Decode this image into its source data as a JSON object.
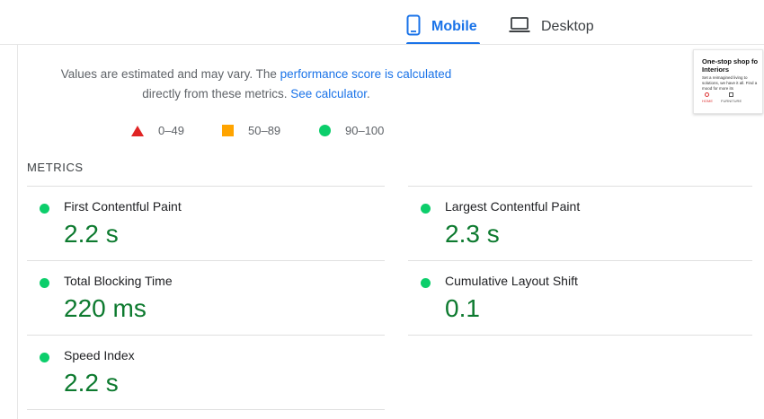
{
  "tabs": {
    "mobile": {
      "label": "Mobile",
      "icon": "smartphone-icon",
      "active": true
    },
    "desktop": {
      "label": "Desktop",
      "icon": "laptop-icon",
      "active": false
    }
  },
  "intro": {
    "text_1": "Values are estimated and may vary. The ",
    "link_score": "performance score is calculated",
    "text_2": "directly from these metrics. ",
    "link_calculator": "See calculator",
    "text_3": "."
  },
  "legend": {
    "fail": {
      "range": "0–49",
      "icon": "triangle-icon",
      "color": "#e02424"
    },
    "average": {
      "range": "50–89",
      "icon": "square-icon",
      "color": "#ffa400"
    },
    "pass": {
      "range": "90–100",
      "icon": "circle-icon",
      "color": "#0cce6b"
    }
  },
  "metrics": {
    "header": "METRICS",
    "fcp": {
      "title": "First Contentful Paint",
      "value": "2.2 s"
    },
    "lcp": {
      "title": "Largest Contentful Paint",
      "value": "2.3 s"
    },
    "tbt": {
      "title": "Total Blocking Time",
      "value": "220 ms"
    },
    "cls": {
      "title": "Cumulative Layout Shift",
      "value": "0.1"
    },
    "si": {
      "title": "Speed Index",
      "value": "2.2 s"
    }
  },
  "thumbnail": {
    "heading": "One-stop shop fo Interiors",
    "subtext": "Set a reimagined living to solutions, we have it all. Find a mood for more its",
    "nav_home": "HOME",
    "nav_furniture": "FURNITURE"
  },
  "colors": {
    "accent": "#1a73e8",
    "pass": "#0cce6b",
    "pass_text": "#0d7a2f"
  }
}
